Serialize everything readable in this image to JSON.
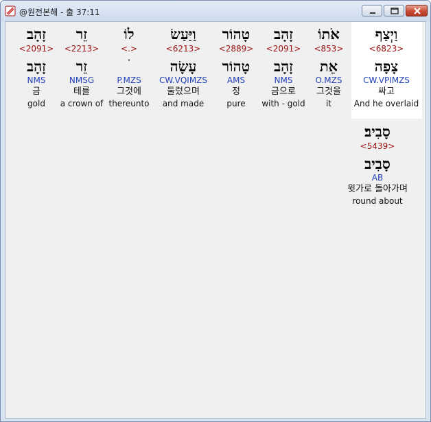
{
  "window": {
    "title": "@원전본해 - 출 37:11",
    "icon": "app-icon"
  },
  "words": [
    {
      "hebrew": "וַיְצַף",
      "strong": "<6823>",
      "root": "צָפָה",
      "morph": "CW.VPIMZS",
      "korean": "싸고",
      "english": "And he overlaid",
      "selected": true
    },
    {
      "hebrew": "אֹתוֹ",
      "strong": "<853>",
      "root": "אֵת",
      "morph": "O.MZS",
      "korean": "그것을",
      "english": "it",
      "selected": false
    },
    {
      "hebrew": "זָהָב",
      "strong": "<2091>",
      "root": "זָהָב",
      "morph": "NMS",
      "korean": "금으로",
      "english": "with - gold",
      "selected": false
    },
    {
      "hebrew": "טָהוֹר",
      "strong": "<2889>",
      "root": "טָהוֹר",
      "morph": "AMS",
      "korean": "정",
      "english": "pure",
      "selected": false
    },
    {
      "hebrew": "וַיַּעַשׂ",
      "strong": "<6213>",
      "root": "עָשָׂה",
      "morph": "CW.VQIMZS",
      "korean": "둘렀으며",
      "english": "and made",
      "selected": false
    },
    {
      "hebrew": "לוֹ",
      "strong": "<.>",
      "root": "ׄ",
      "morph": "P.MZS",
      "korean": "그것에",
      "english": "thereunto",
      "selected": false
    },
    {
      "hebrew": "זֵר",
      "strong": "<2213>",
      "root": "זֵר",
      "morph": "NMSG",
      "korean": "테를",
      "english": "a crown of",
      "selected": false
    },
    {
      "hebrew": "זָהָב",
      "strong": "<2091>",
      "root": "זָהָב",
      "morph": "NMS",
      "korean": "금",
      "english": "gold",
      "selected": false
    },
    {
      "hebrew": "סָבִיב׃",
      "strong": "<5439>",
      "root": "סָבִיב",
      "morph": "AB",
      "korean": "윗가로 돌아가며",
      "english": "round about",
      "selected": false
    }
  ]
}
